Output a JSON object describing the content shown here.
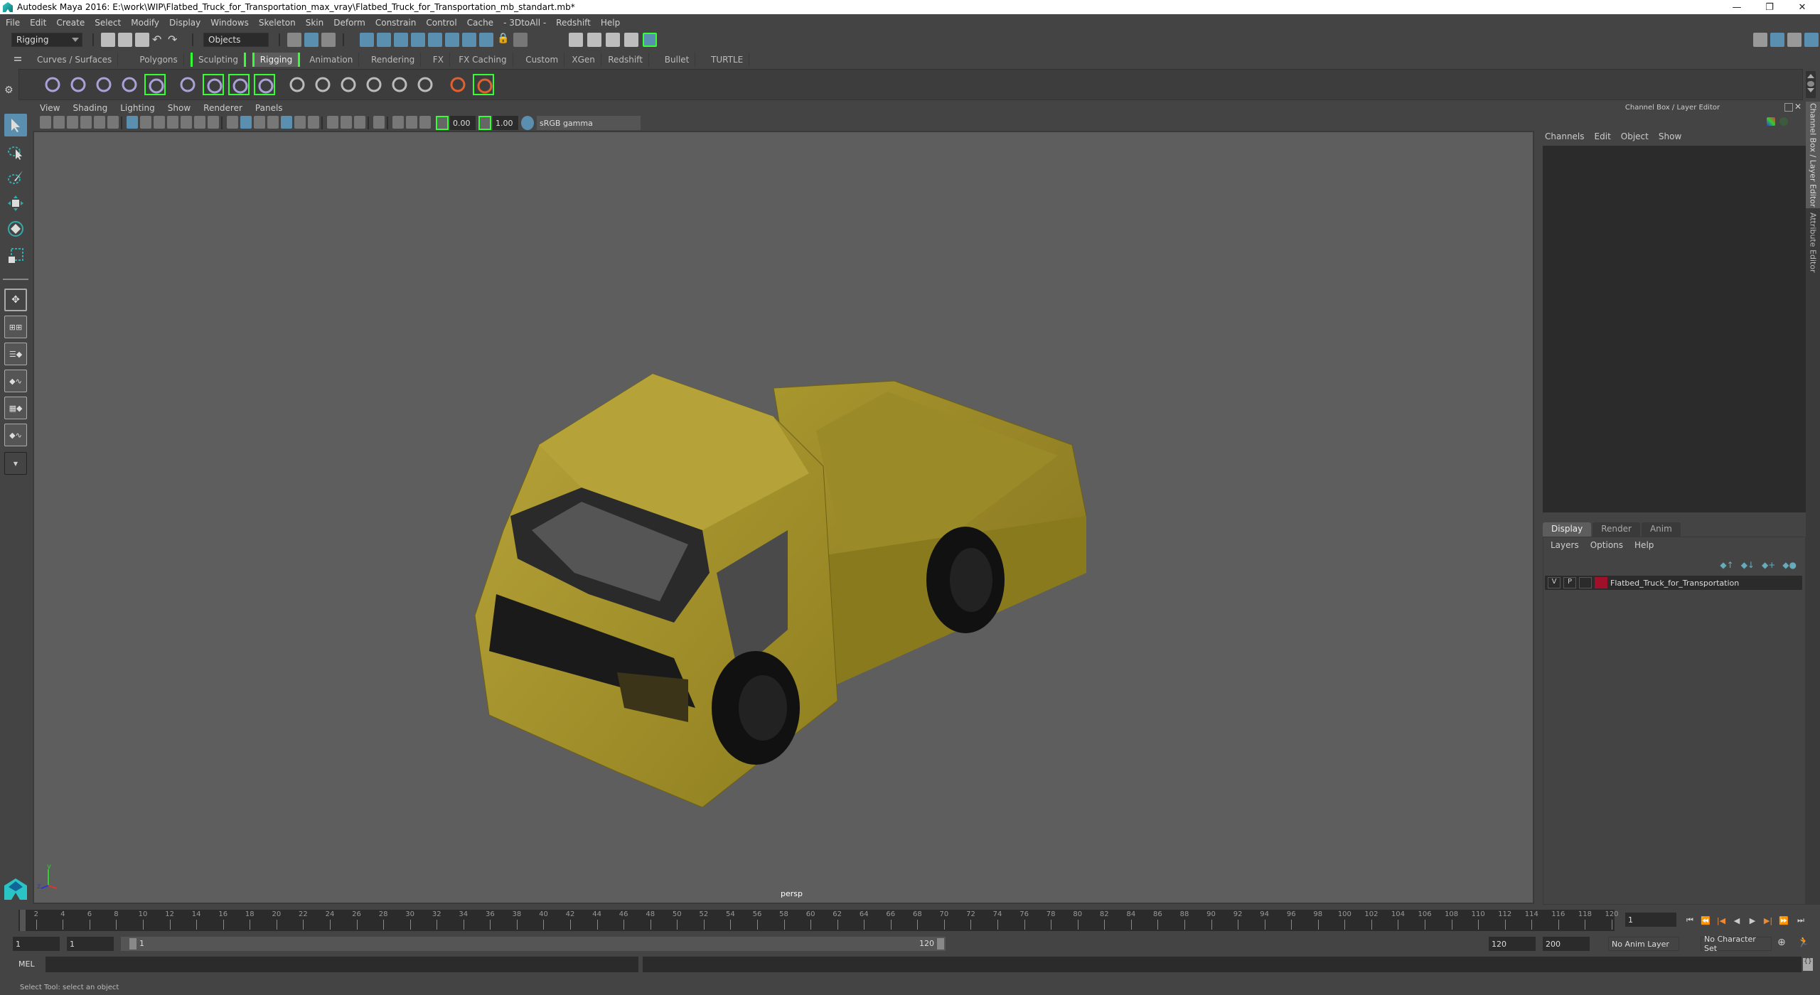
{
  "window": {
    "title": "Autodesk Maya 2016: E:\\work\\WIP\\Flatbed_Truck_for_Transportation_max_vray\\Flatbed_Truck_for_Transportation_mb_standart.mb*",
    "minimize": "—",
    "maximize": "❐",
    "close": "✕"
  },
  "menubar": [
    "File",
    "Edit",
    "Create",
    "Select",
    "Modify",
    "Display",
    "Windows",
    "Skeleton",
    "Skin",
    "Deform",
    "Constrain",
    "Control",
    "Cache",
    "- 3DtoAll -",
    "Redshift",
    "Help"
  ],
  "statusline": {
    "menuset": "Rigging",
    "selection_mode": "Objects"
  },
  "shelf_tabs": [
    {
      "label": "Curves / Surfaces"
    },
    {
      "label": "Polygons"
    },
    {
      "label": "Sculpting",
      "bracket": true
    },
    {
      "label": "Rigging",
      "active": true,
      "bracket": true
    },
    {
      "label": "Animation"
    },
    {
      "label": "Rendering"
    },
    {
      "label": "FX"
    },
    {
      "label": "FX Caching"
    },
    {
      "label": "Custom"
    },
    {
      "label": "XGen"
    },
    {
      "label": "Redshift"
    },
    {
      "label": "Bullet"
    },
    {
      "label": "TURTLE"
    }
  ],
  "shelf_icons": [
    "joint-tool-icon",
    "ik-handle-icon",
    "ik-spline-icon",
    "insert-joint-icon",
    "human-ik-icon",
    "bind-skin-icon",
    "smooth-bind-icon",
    "lattice-icon",
    "cluster-icon",
    "parent-constraint-icon",
    "point-constraint-icon",
    "orient-constraint-icon",
    "scale-constraint-icon",
    "aim-constraint-icon",
    "pole-vector-icon",
    "locator-icon",
    "parent-locator-icon"
  ],
  "viewport": {
    "menu": [
      "View",
      "Shading",
      "Lighting",
      "Show",
      "Renderer",
      "Panels"
    ],
    "exposure": "0.00",
    "gamma": "1.00",
    "color_space": "sRGB gamma",
    "camera": "persp"
  },
  "right_panel": {
    "title": "Channel Box / Layer Editor",
    "channel_menu": [
      "Channels",
      "Edit",
      "Object",
      "Show"
    ],
    "layer_tabs": [
      "Display",
      "Render",
      "Anim"
    ],
    "active_layer_tab": "Display",
    "layer_menu": [
      "Layers",
      "Options",
      "Help"
    ],
    "layers": [
      {
        "v": "V",
        "p": "P",
        "color": "#a0102a",
        "name": "Flatbed_Truck_for_Transportation"
      }
    ],
    "side_tabs": [
      "Channel Box / Layer Editor",
      "Attribute Editor"
    ]
  },
  "timeline": {
    "start": 1,
    "end": 120,
    "step": 2,
    "current_frame": "1"
  },
  "range": {
    "start": "1",
    "anim_start": "1",
    "slider_start": "1",
    "slider_end": "120",
    "end": "120",
    "anim_end": "200",
    "anim_layer": "No Anim Layer",
    "char_set": "No Character Set"
  },
  "command_line": {
    "label": "MEL",
    "value": ""
  },
  "help_line": "Select Tool: select an object"
}
